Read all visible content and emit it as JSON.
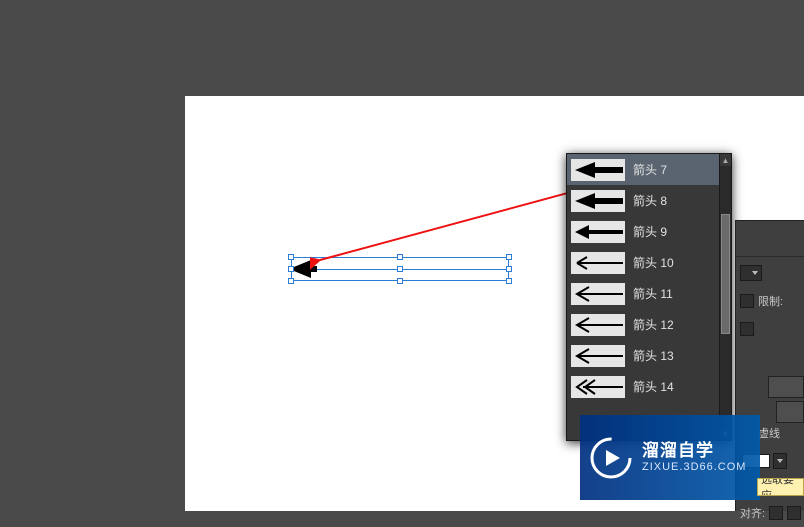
{
  "canvas": {
    "selected_object": "arrow-object"
  },
  "arrow_dropdown": {
    "items": [
      {
        "label": "箭头 7",
        "style": "wide-solid"
      },
      {
        "label": "箭头 8",
        "style": "wide-solid"
      },
      {
        "label": "箭头 9",
        "style": "line-solid"
      },
      {
        "label": "箭头 10",
        "style": "thin-line"
      },
      {
        "label": "箭头 11",
        "style": "line-open"
      },
      {
        "label": "箭头 12",
        "style": "line-open"
      },
      {
        "label": "箭头 13",
        "style": "line-open"
      },
      {
        "label": "箭头 14",
        "style": "double-chevron"
      }
    ],
    "selected_index": 0
  },
  "props": {
    "limit_label": "限制:",
    "dash_label": "虚线",
    "align_label": "对齐:"
  },
  "tooltip": {
    "text": "选取要应"
  },
  "watermark": {
    "title": "溜溜自学",
    "url": "ZIXUE.3D66.COM",
    "icon_name": "play-triangle-icon"
  }
}
